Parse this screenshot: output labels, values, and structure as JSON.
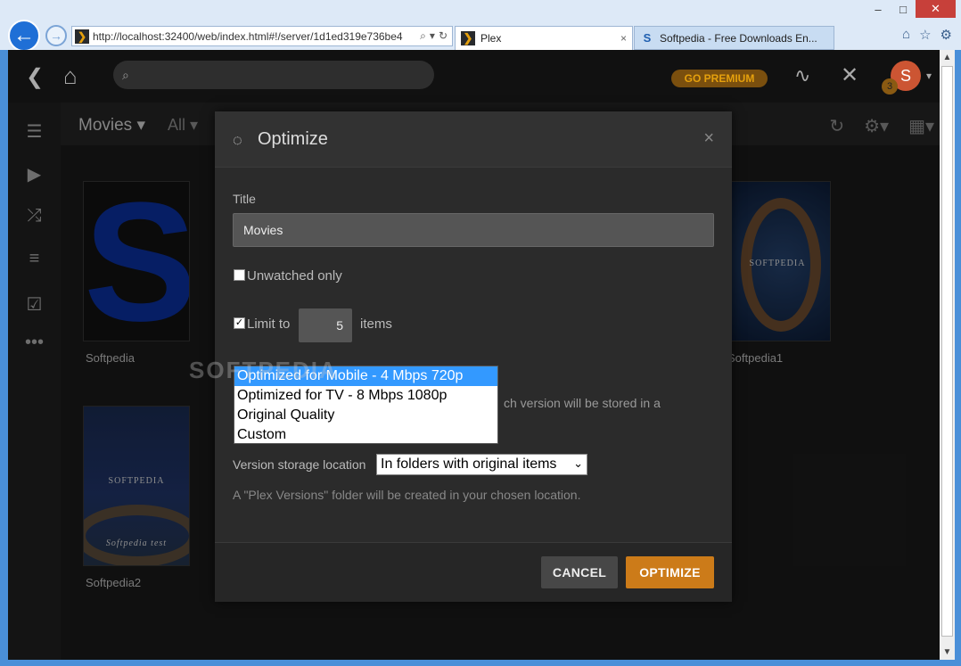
{
  "browser": {
    "address": "http://localhost:32400/web/index.html#!/server/1d1ed319e736be4",
    "tabs": [
      {
        "label": "Plex",
        "active": true
      },
      {
        "label": "Softpedia - Free Downloads En...",
        "active": false
      }
    ],
    "back_glyph": "←",
    "forward_glyph": "→",
    "tab_close_glyph": "×",
    "window_controls": [
      "–",
      "□",
      "✕"
    ]
  },
  "plex_header": {
    "premium_label": "GO PREMIUM",
    "avatar_letter": "S",
    "notification_count": "3"
  },
  "library": {
    "section_label": "Movies ▾",
    "filter_label": "All ▾",
    "items": [
      {
        "title": "Softpedia"
      },
      {
        "title": "Softpedia1"
      },
      {
        "title": "Softpedia2"
      }
    ],
    "poster_text": "SOFTPEDIA",
    "poster_text2": "SOFTPEDIA",
    "poster_script": "Softpedia test"
  },
  "modal": {
    "title": "Optimize",
    "close_glyph": "×",
    "title_label": "Title",
    "title_value": "Movies",
    "unwatched_label": "Unwatched only",
    "unwatched_checked": false,
    "limit_label": "Limit to",
    "limit_checked": true,
    "limit_value": "5",
    "limit_suffix": "items",
    "description_partial": "ch version will be stored in a",
    "storage_label": "Version storage location",
    "storage_value": "In folders with original items",
    "note": "A \"Plex Versions\" folder will be created in your chosen location.",
    "cancel_label": "CANCEL",
    "optimize_label": "OPTIMIZE"
  },
  "quality_dropdown": {
    "options": [
      "Optimized for Mobile - 4 Mbps 720p",
      "Optimized for TV - 8 Mbps 1080p",
      "Original Quality",
      "Custom"
    ],
    "selected_index": 0
  },
  "watermark": "SOFTPEDIA",
  "colors": {
    "accent": "#cc7b19",
    "selection": "#3399ff"
  }
}
